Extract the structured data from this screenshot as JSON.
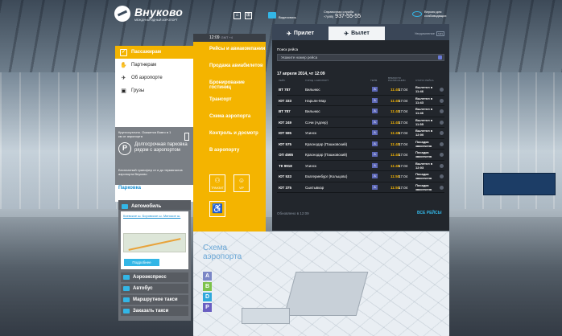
{
  "header": {
    "logo_name": "Внуково",
    "logo_sub": "МЕЖДУНАРОДНЫЙ АЭРОПОРТ",
    "video_label": "Видеосвязь",
    "info_title": "Справочная служба",
    "info_code": "+7(495)",
    "info_phone": "937-55-55",
    "vision_label": "Версия для слабовидящих"
  },
  "left_menu": {
    "items": [
      {
        "label": "Пассажирам",
        "icon": "passenger-icon",
        "active": true
      },
      {
        "label": "Партнерам",
        "icon": "handshake-icon",
        "active": false
      },
      {
        "label": "Об аэропорте",
        "icon": "plane-icon",
        "active": false
      },
      {
        "label": "Грузы",
        "icon": "cargo-icon",
        "active": false
      }
    ]
  },
  "promo": {
    "text1": "Круглосуточно. Окажется Вовго в 1 км от аэропорта",
    "parking_title": "Долгосрочная парковка рядом с аэропортом",
    "text2": "Бесплатный трансфер от и до терминалов аэропорта Внуково",
    "parking_link": "Парковка"
  },
  "submenu": {
    "time": "12:09",
    "time_suffix": "GMT +4",
    "items": [
      "Рейсы и авиакомпании",
      "Продажа авиабилетов",
      "Бронирование гостиниц",
      "Трансорт",
      "Схема аэропорта",
      "Контроль и досмотр",
      "В аэропорту"
    ],
    "icon_luggage": "ТРАНЗИТ",
    "icon_vip": "VIP"
  },
  "transport": {
    "title": "Автомобиль",
    "links": "Киевское ш. Боровское ш. Минское ш.",
    "more": "Подробнее",
    "rows": [
      "Аэроэкспресс",
      "Автобус",
      "Маршрутное такси",
      "Заказать такси"
    ]
  },
  "scheme": {
    "title_line1": "Схема",
    "title_line2": "аэропорта",
    "badges": [
      {
        "label": "A",
        "color": "#7a86c6"
      },
      {
        "label": "B",
        "color": "#7cc24a"
      },
      {
        "label": "D",
        "color": "#2fa8dc"
      },
      {
        "label": "P",
        "color": "#6a5fc2"
      }
    ]
  },
  "flights": {
    "tab_arrivals": "Прилет",
    "tab_departures": "Вылет",
    "legend_label": "Уведомление",
    "legend_box": "SMS",
    "search_label": "Поиск рейса",
    "search_placeholder": "Укажите номер рейса",
    "date": "17 апреля 2014, чт 12:09",
    "headers": {
      "flight": "РЕЙС",
      "city": "ГОРОД / АЭРОПОРТ",
      "term": "ТЕРМ.",
      "time": "ВРЕМЯ ПО РАСПИСАНИЮ",
      "status": "СТАТУС РЕЙСА"
    },
    "rows": [
      {
        "num": "ВТ 787",
        "city": "Вильнюс",
        "term": "A",
        "sched": "11:40",
        "act": "17.04",
        "status": "Вылетел в 11:46"
      },
      {
        "num": "ЮТ 333",
        "city": "Нарьян-Мар",
        "term": "A",
        "sched": "11:40",
        "act": "17.04",
        "status": "Вылетел в 11:43"
      },
      {
        "num": "ВТ 787",
        "city": "Вильнюс",
        "term": "A",
        "sched": "11:40",
        "act": "17.04",
        "status": "Вылетел в 11:46"
      },
      {
        "num": "ЮТ 249",
        "city": "Сочи (Адлер)",
        "term": "A",
        "sched": "11:40",
        "act": "17.04",
        "status": "Вылетел в 11:55"
      },
      {
        "num": "ЮТ 595",
        "city": "Усинск",
        "term": "A",
        "sched": "11:45",
        "act": "17.04",
        "status": "Вылетел в 12:00"
      },
      {
        "num": "ЮТ 575",
        "city": "Краснодар (Пашковский)",
        "term": "A",
        "sched": "11:40",
        "act": "17.04",
        "status": "Посадка закончена"
      },
      {
        "num": "ОП 4565",
        "city": "Краснодар (Пашковский)",
        "term": "A",
        "sched": "11:40",
        "act": "17.04",
        "status": "Посадка закончена"
      },
      {
        "num": "ТК 9918",
        "city": "Усинск",
        "term": "A",
        "sched": "11:45",
        "act": "17.04",
        "status": "Вылетел в 12:03"
      },
      {
        "num": "ЮТ 533",
        "city": "Екатеринбург (Кольцово)",
        "term": "A",
        "sched": "11:50",
        "act": "17.04",
        "status": "Посадка закончена"
      },
      {
        "num": "ЮТ 375",
        "city": "Сыктывкар",
        "term": "A",
        "sched": "11:50",
        "act": "17.04",
        "status": "Посадка закончена"
      }
    ],
    "footer_updated": "Обновлено в 12:09",
    "all_flights": "ВСЕ РЕЙСЫ"
  },
  "colors": {
    "accent_yellow": "#f4b400",
    "accent_blue": "#33b6e6",
    "panel_dark": "#22262c"
  }
}
